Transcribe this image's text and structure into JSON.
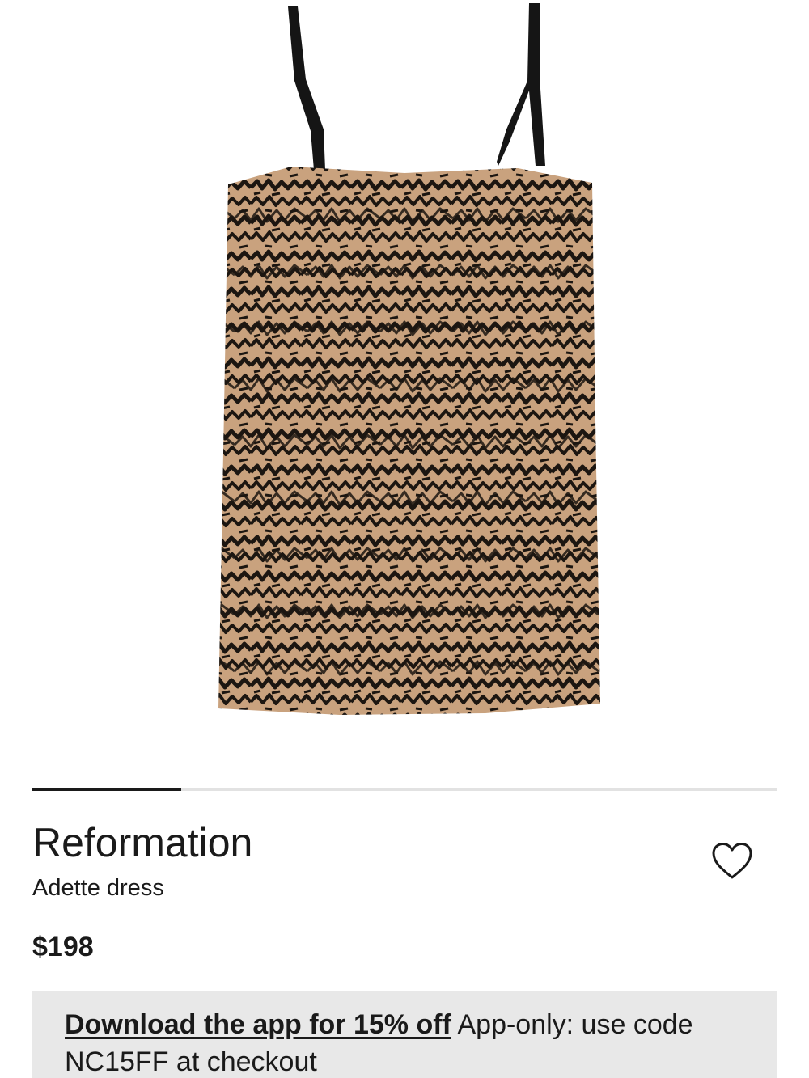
{
  "product": {
    "brand": "Reformation",
    "name": "Adette dress",
    "price": "$198",
    "image": {
      "description_icon": "zebra-print-slip-dress",
      "colors": {
        "fabric_base": "#c9a27e",
        "print": "#1c1611",
        "straps": "#151515"
      }
    }
  },
  "carousel": {
    "current": 1,
    "progress_fraction": 0.2
  },
  "wishlist": {
    "icon": "heart-icon"
  },
  "promo": {
    "link_text": "Download the app for 15% off",
    "text": " App-only: use code NC15FF at checkout"
  },
  "colors": {
    "text": "#1a1a1a",
    "promo_bg": "#e8e8e8",
    "track": "#e2e2e2"
  }
}
